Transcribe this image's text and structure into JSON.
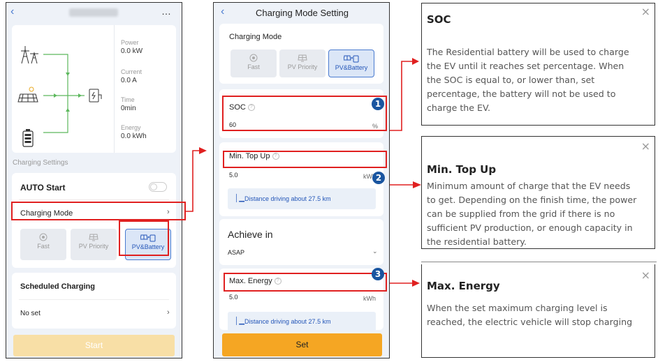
{
  "left_phone": {
    "device_name": "",
    "more_icon": "…",
    "stats": [
      {
        "label": "Power",
        "value": "0.0 kW"
      },
      {
        "label": "Current",
        "value": "0.0 A"
      },
      {
        "label": "Time",
        "value": "0min"
      },
      {
        "label": "Energy",
        "value": "0.0 kWh"
      }
    ],
    "charging_settings_label": "Charging Settings",
    "auto_start_label": "AUTO Start",
    "charging_mode_label": "Charging Mode",
    "modes": [
      "Fast",
      "PV Priority",
      "PV&Battery"
    ],
    "selected_mode": "PV&Battery",
    "scheduled_label": "Scheduled Charging",
    "no_set_label": "No set",
    "start_button": "Start"
  },
  "right_phone": {
    "title": "Charging Mode Setting",
    "charging_mode_label": "Charging Mode",
    "modes": [
      "Fast",
      "PV Priority",
      "PV&Battery"
    ],
    "selected_mode": "PV&Battery",
    "soc_label": "SOC",
    "soc_value": "60",
    "soc_unit": "%",
    "min_top_up_label": "Min. Top Up",
    "min_top_up_value": "5.0",
    "min_top_up_unit": "kWh",
    "min_distance": "Distance driving about 27.5 km",
    "achieve_label": "Achieve in",
    "achieve_value": "ASAP",
    "max_energy_label": "Max. Energy",
    "max_energy_value": "5.0",
    "max_energy_unit": "kWh",
    "max_distance": "Distance driving about 27.5 km",
    "set_button": "Set"
  },
  "badges": [
    "1",
    "2",
    "3"
  ],
  "info_panels": [
    {
      "title": "SOC",
      "lines": [
        "The Residential battery will be used to charge",
        "the EV until it reaches set percentage. When",
        "the SOC is equal to, or lower than, set",
        "percentage, the battery will not be used to",
        "charge the EV."
      ]
    },
    {
      "title": "Min. Top Up",
      "lines": [
        "Minimum amount of charge that the EV needs",
        "to get. Depending on the finish time, the power",
        "can be supplied from the grid if there is no",
        "sufficient PV production, or enough capacity in",
        "the residential battery."
      ]
    },
    {
      "title": "Max. Energy",
      "lines": [
        "When the set maximum charging level is",
        "reached, the electric vehicle will stop charging"
      ]
    }
  ],
  "close_icon": "×",
  "colors": {
    "accent": "#2456b8",
    "highlight": "#e02020",
    "set_button": "#f5a623",
    "start_button": "#f8dfa6",
    "badge": "#1a55a0"
  }
}
